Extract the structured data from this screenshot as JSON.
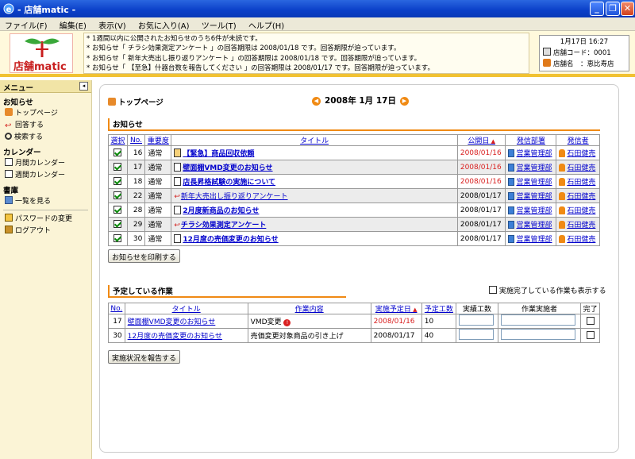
{
  "window": {
    "title": "- 店舗matic -"
  },
  "menubar": [
    "ファイル(F)",
    "編集(E)",
    "表示(V)",
    "お気に入り(A)",
    "ツール(T)",
    "ヘルプ(H)"
  ],
  "header": {
    "logo_text": "店舗matic",
    "notices": [
      "* 1週間以内に公開されたお知らせのうち6件が未読です。",
      "* お知らせ「 チラシ効果測定アンケート 」の回答期限は 2008/01/18 です。回答期限が迫っています。",
      "* お知らせ「 新年大売出し振り返りアンケート 」の回答期限は 2008/01/18 です。回答期限が迫っています。",
      "* お知らせ「 【至急】什器台数を報告してください 」の回答期限は 2008/01/17 です。回答期限が迫っています。"
    ],
    "info": {
      "datetime": "1月17日 16:27",
      "store_code": "店舗コード：0001",
      "store_name": "店舗名　：恵比寿店"
    }
  },
  "sidebar": {
    "header": "メニュー",
    "sections": {
      "news": "お知らせ",
      "calendar": "カレンダー",
      "library": "書庫"
    },
    "items": {
      "toppage": "トップページ",
      "answer": "回答する",
      "search": "検索する",
      "monthly": "月間カレンダー",
      "weekly": "週間カレンダー",
      "list": "一覧を見る",
      "password": "パスワードの変更",
      "logout": "ログアウト"
    }
  },
  "main": {
    "toppage_label": "トップページ",
    "date": "2008年 1月 17日",
    "news": {
      "title": "お知らせ",
      "columns": [
        "選択",
        "No.",
        "重要度",
        "タイトル",
        "公開日",
        "発信部署",
        "発信者"
      ],
      "rows": [
        {
          "no": "16",
          "importance": "通常",
          "title": "【緊急】商品回収依頼",
          "date": "2008/01/16",
          "dept": "営業管理部",
          "sender": "石田健売",
          "checked": true,
          "icon": "doc-hot",
          "bold": true,
          "red": true
        },
        {
          "no": "17",
          "importance": "通常",
          "title": "壁面棚VMD変更のお知らせ",
          "date": "2008/01/16",
          "dept": "営業管理部",
          "sender": "石田健売",
          "checked": true,
          "icon": "doc",
          "bold": true,
          "red": true
        },
        {
          "no": "18",
          "importance": "通常",
          "title": "店長昇格試験の実施について",
          "date": "2008/01/16",
          "dept": "営業管理部",
          "sender": "石田健売",
          "checked": true,
          "icon": "doc",
          "bold": true,
          "red": true
        },
        {
          "no": "22",
          "importance": "通常",
          "title": "新年大売出し振り返りアンケート",
          "date": "2008/01/17",
          "dept": "営業管理部",
          "sender": "石田健売",
          "checked": true,
          "icon": "arrow",
          "bold": false,
          "red": false
        },
        {
          "no": "28",
          "importance": "通常",
          "title": "2月度新商品のお知らせ",
          "date": "2008/01/17",
          "dept": "営業管理部",
          "sender": "石田健売",
          "checked": true,
          "icon": "doc",
          "bold": true,
          "red": false
        },
        {
          "no": "29",
          "importance": "通常",
          "title": "チラシ効果測定アンケート",
          "date": "2008/01/17",
          "dept": "営業管理部",
          "sender": "石田健売",
          "checked": true,
          "icon": "arrow",
          "bold": true,
          "red": false
        },
        {
          "no": "30",
          "importance": "通常",
          "title": "12月度の売価変更のお知らせ",
          "date": "2008/01/17",
          "dept": "営業管理部",
          "sender": "石田健売",
          "checked": true,
          "icon": "doc",
          "bold": true,
          "red": false
        }
      ],
      "print_button": "お知らせを印刷する"
    },
    "tasks": {
      "title": "予定している作業",
      "show_completed_label": "実施完了している作業も表示する",
      "columns": [
        "No.",
        "タイトル",
        "作業内容",
        "実施予定日",
        "予定工数",
        "実績工数",
        "作業実施者",
        "完了"
      ],
      "rows": [
        {
          "no": "17",
          "title": "壁面棚VMD変更のお知らせ",
          "content": "VMD変更",
          "date": "2008/01/16",
          "hours": "10",
          "red": true
        },
        {
          "no": "30",
          "title": "12月度の売価変更のお知らせ",
          "content": "売価変更対象商品の引き上げ",
          "date": "2008/01/17",
          "hours": "40",
          "red": false
        }
      ],
      "report_button": "実施状況を報告する"
    }
  }
}
